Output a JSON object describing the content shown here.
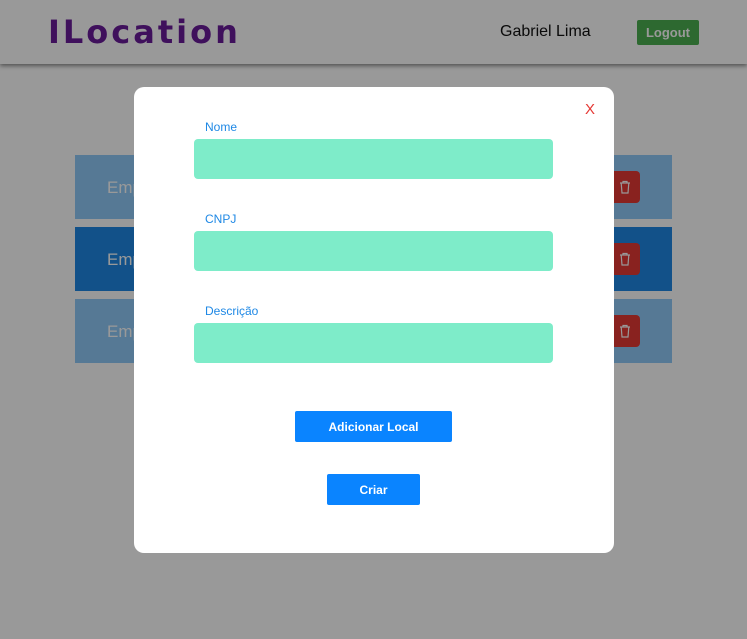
{
  "header": {
    "brand": "ILocation",
    "user_name": "Gabriel Lima",
    "logout_label": "Logout"
  },
  "companies": [
    {
      "label": "Emp"
    },
    {
      "label": "Emp"
    },
    {
      "label": "Emp"
    }
  ],
  "modal": {
    "close_label": "X",
    "fields": {
      "nome": {
        "label": "Nome",
        "value": ""
      },
      "cnpj": {
        "label": "CNPJ",
        "value": ""
      },
      "descricao": {
        "label": "Descrição",
        "value": ""
      }
    },
    "add_local_label": "Adicionar Local",
    "create_label": "Criar"
  },
  "icons": {
    "delete": "trash-icon"
  },
  "colors": {
    "brand": "#6a1b9a",
    "logout": "#4caf50",
    "row_light": "#90caf9",
    "row_dark": "#1e88e5",
    "delete": "#e53935",
    "input_bg": "#7eecc9",
    "field_label": "#1e88e5",
    "primary_button": "#0a84ff",
    "close": "#e53935"
  }
}
